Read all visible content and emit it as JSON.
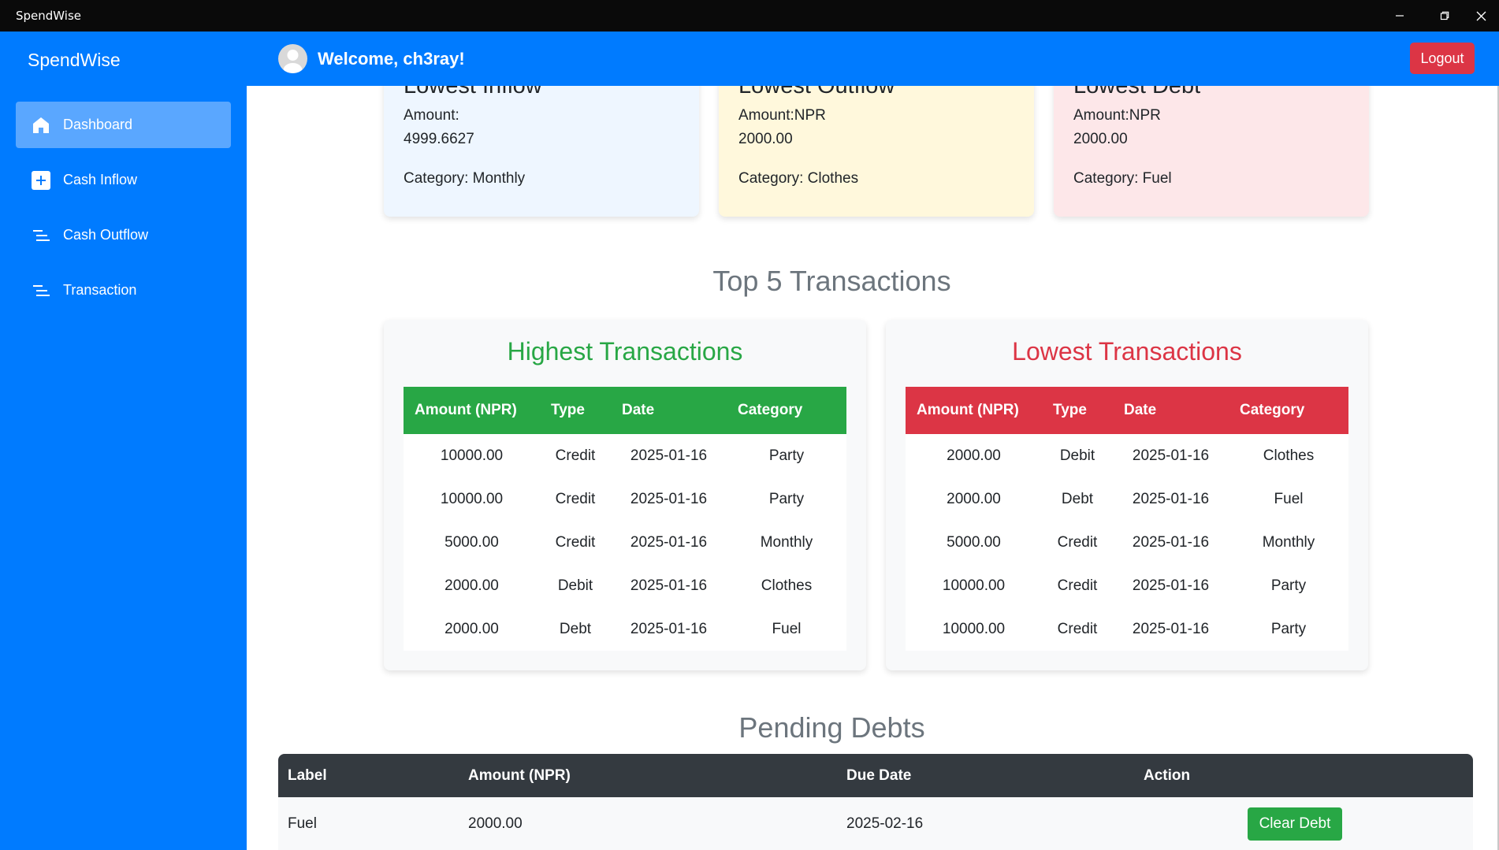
{
  "window": {
    "title": "SpendWise"
  },
  "sidebar": {
    "brand": "SpendWise",
    "items": [
      {
        "label": "Dashboard",
        "icon": "home-icon",
        "active": true
      },
      {
        "label": "Cash Inflow",
        "icon": "plus-square-icon"
      },
      {
        "label": "Cash Outflow",
        "icon": "lines-icon"
      },
      {
        "label": "Transaction",
        "icon": "lines-icon"
      }
    ]
  },
  "header": {
    "welcome": "Welcome, ch3ray!",
    "logout_label": "Logout"
  },
  "summary": [
    {
      "title": "Lowest Inflow",
      "amount_label": "Amount:",
      "amount_value": "4999.6627",
      "category": "Category: Monthly",
      "bg": "#eef6ff"
    },
    {
      "title": "Lowest Outflow",
      "amount_label": "Amount:NPR",
      "amount_value": "2000.00",
      "category": "Category: Clothes",
      "bg": "#fff8dc"
    },
    {
      "title": "Lowest Debt",
      "amount_label": "Amount:NPR",
      "amount_value": "2000.00",
      "category": "Category: Fuel",
      "bg": "#fde7e9"
    }
  ],
  "top5": {
    "title": "Top 5 Transactions",
    "headers": [
      "Amount (NPR)",
      "Type",
      "Date",
      "Category"
    ],
    "highest": {
      "title": "Highest Transactions",
      "color": "#28a745",
      "rows": [
        [
          "10000.00",
          "Credit",
          "2025-01-16",
          "Party"
        ],
        [
          "10000.00",
          "Credit",
          "2025-01-16",
          "Party"
        ],
        [
          "5000.00",
          "Credit",
          "2025-01-16",
          "Monthly"
        ],
        [
          "2000.00",
          "Debit",
          "2025-01-16",
          "Clothes"
        ],
        [
          "2000.00",
          "Debt",
          "2025-01-16",
          "Fuel"
        ]
      ]
    },
    "lowest": {
      "title": "Lowest Transactions",
      "color": "#dc3545",
      "rows": [
        [
          "2000.00",
          "Debit",
          "2025-01-16",
          "Clothes"
        ],
        [
          "2000.00",
          "Debt",
          "2025-01-16",
          "Fuel"
        ],
        [
          "5000.00",
          "Credit",
          "2025-01-16",
          "Monthly"
        ],
        [
          "10000.00",
          "Credit",
          "2025-01-16",
          "Party"
        ],
        [
          "10000.00",
          "Credit",
          "2025-01-16",
          "Party"
        ]
      ]
    }
  },
  "debts": {
    "title": "Pending Debts",
    "headers": [
      "Label",
      "Amount (NPR)",
      "Due Date",
      "Action"
    ],
    "rows": [
      {
        "label": "Fuel",
        "amount": "2000.00",
        "due": "2025-02-16",
        "action": "Clear Debt"
      }
    ]
  }
}
